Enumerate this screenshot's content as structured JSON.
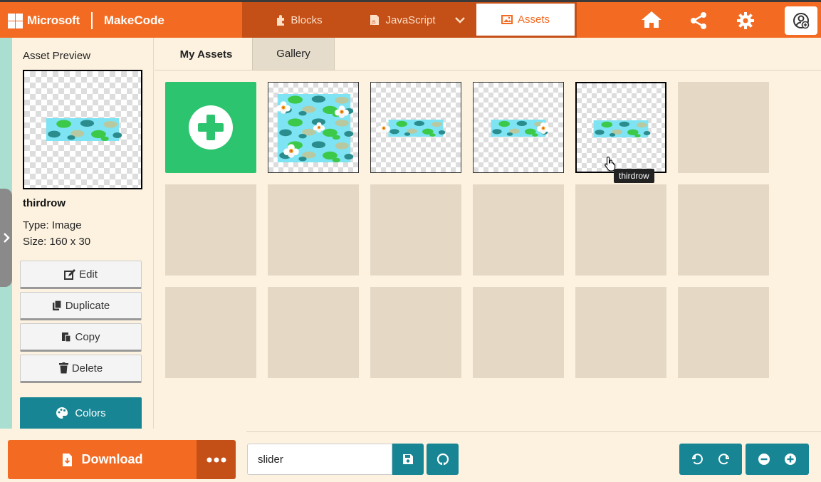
{
  "brand": {
    "company": "Microsoft",
    "product": "MakeCode"
  },
  "editor_tabs": [
    {
      "label": "Blocks",
      "icon": "puzzle-icon"
    },
    {
      "label": "JavaScript",
      "icon": "js-icon"
    },
    {
      "label": "Assets",
      "icon": "image-icon",
      "active": true
    }
  ],
  "top_icons": [
    "home-icon",
    "share-icon",
    "gear-icon",
    "account-icon"
  ],
  "sidebar": {
    "title": "Asset Preview",
    "asset_name": "thirdrow",
    "asset_type": "Type: Image",
    "asset_size": "Size: 160 x 30",
    "buttons": {
      "edit": "Edit",
      "duplicate": "Duplicate",
      "copy": "Copy",
      "delete": "Delete"
    },
    "colors_label": "Colors"
  },
  "gallery_tabs": {
    "my_assets": "My Assets",
    "gallery": "Gallery"
  },
  "tooltip": "thirdrow",
  "bottom": {
    "download_label": "Download",
    "project_name": "slider"
  },
  "colors": {
    "orange": "#f36b22",
    "dark_orange": "#c44f17",
    "teal": "#188594",
    "green": "#2cc46f",
    "cream": "#fdf2e0"
  }
}
